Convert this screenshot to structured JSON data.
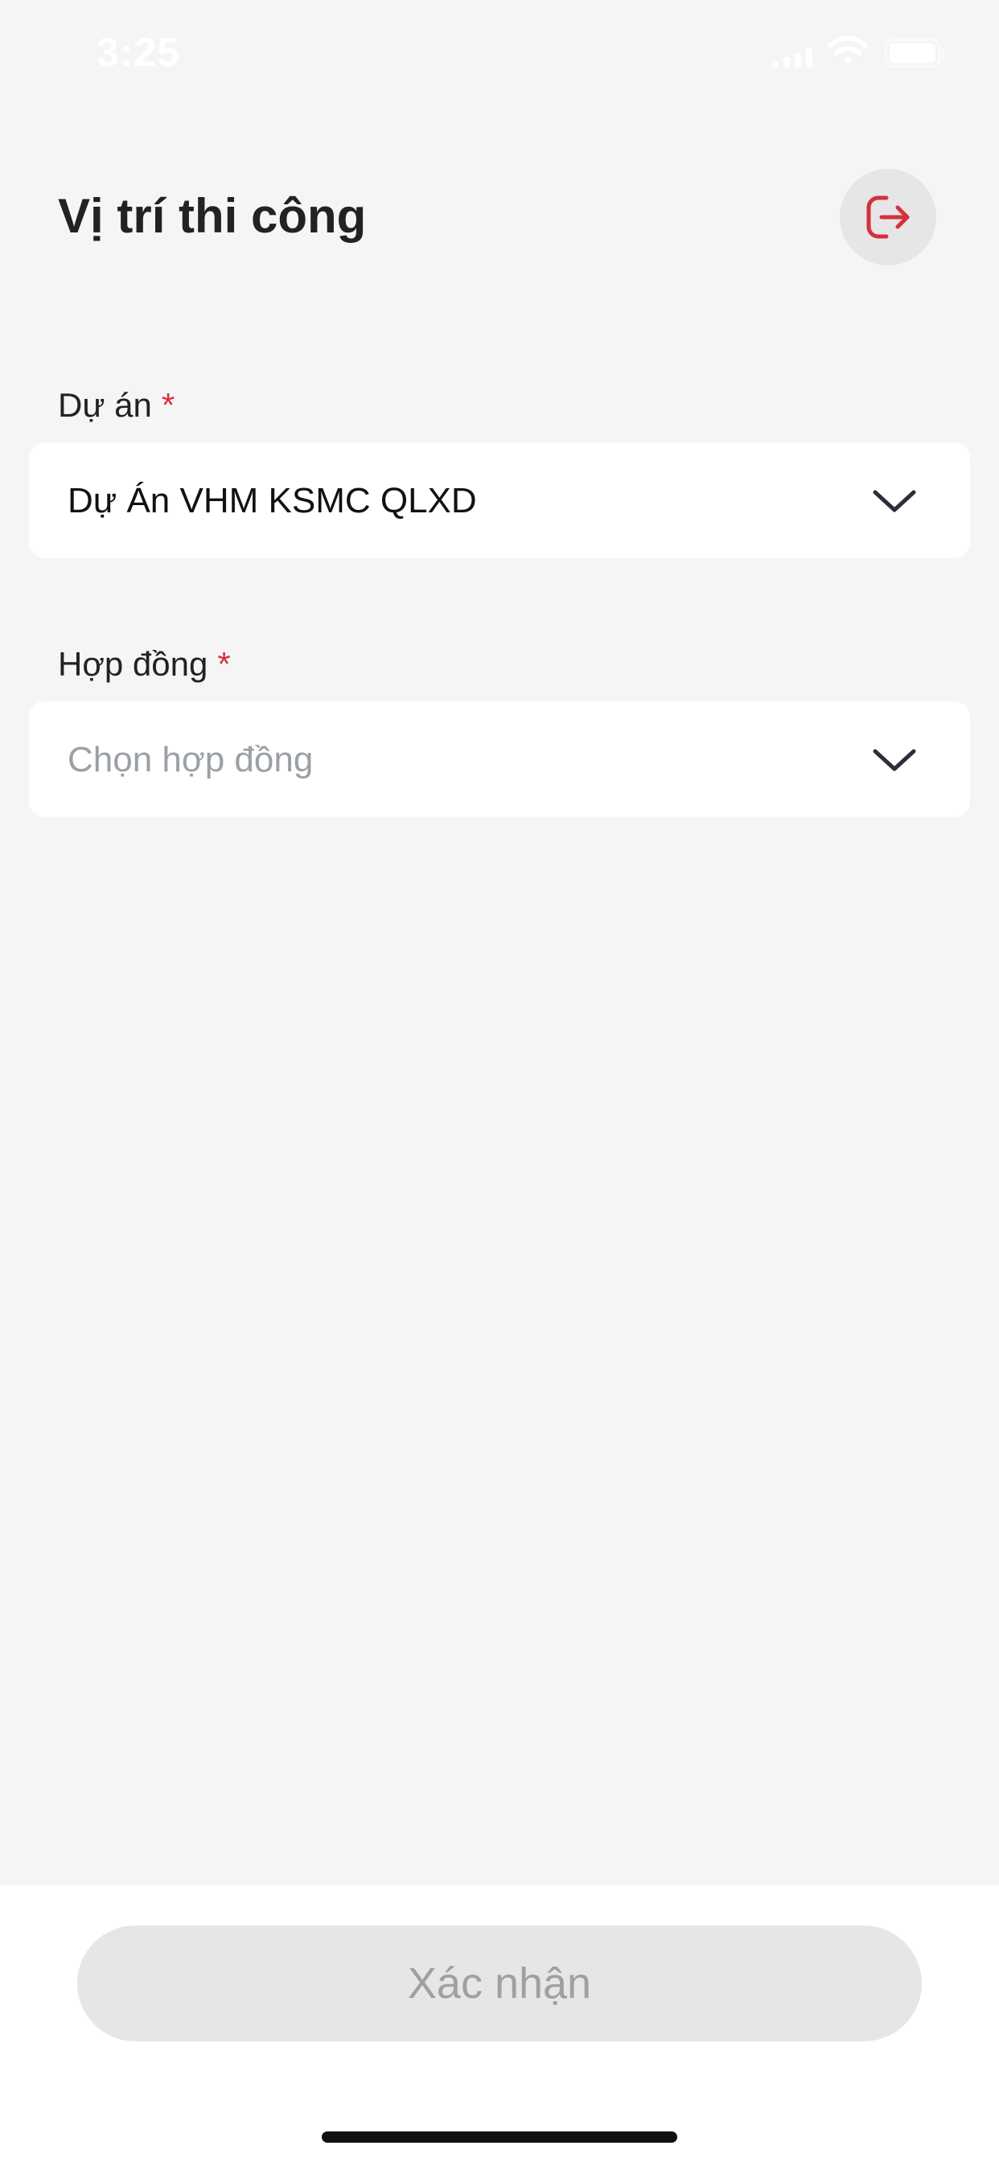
{
  "status_bar": {
    "time": "3:25"
  },
  "header": {
    "title": "Vị trí thi công",
    "logout_icon": "logout-icon"
  },
  "form": {
    "project": {
      "label": "Dự án",
      "required_mark": "*",
      "value": "Dự Án VHM KSMC QLXD"
    },
    "contract": {
      "label": "Hợp đồng",
      "required_mark": "*",
      "placeholder": "Chọn hợp đồng"
    }
  },
  "footer": {
    "confirm_label": "Xác nhận"
  },
  "colors": {
    "background": "#f5f5f5",
    "accent": "#d5303e",
    "disabled_button": "#e6e6e6",
    "disabled_text": "#a0a0a0",
    "placeholder_text": "#9aa0a6"
  }
}
